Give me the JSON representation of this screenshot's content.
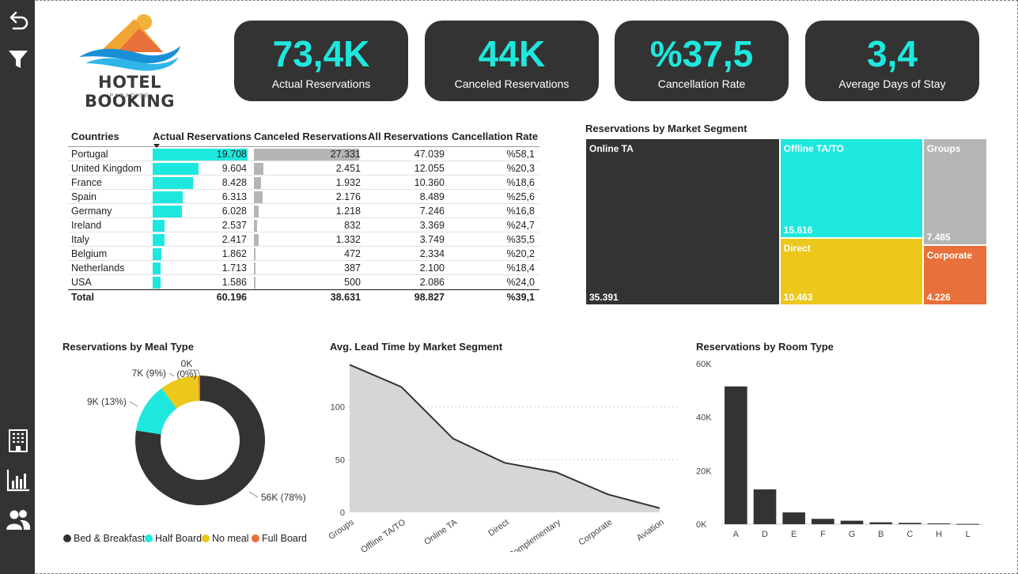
{
  "logo": {
    "title": "HOTEL BOOKING",
    "subtitle": "PARADISE"
  },
  "kpis": [
    {
      "value": "73,4K",
      "label": "Actual Reservations"
    },
    {
      "value": "44K",
      "label": "Canceled Reservations"
    },
    {
      "value": "%37,5",
      "label": "Cancellation Rate"
    },
    {
      "value": "3,4",
      "label": "Average Days of Stay"
    }
  ],
  "sidebar": {
    "icons": [
      "back-arrow-icon",
      "filter-icon",
      "building-icon",
      "bar-chart-icon",
      "users-icon"
    ]
  },
  "table": {
    "headers": [
      "Countries",
      "Actual Reservations",
      "Canceled Reservations",
      "All Reservations",
      "Cancellation Rate"
    ],
    "rows": [
      {
        "country": "Portugal",
        "actual": "19.708",
        "canceled": "27.331",
        "all": "47.039",
        "rate": "%58,1",
        "actual_n": 19708,
        "canceled_n": 27331
      },
      {
        "country": "United Kingdom",
        "actual": "9.604",
        "canceled": "2.451",
        "all": "12.055",
        "rate": "%20,3",
        "actual_n": 9604,
        "canceled_n": 2451
      },
      {
        "country": "France",
        "actual": "8.428",
        "canceled": "1.932",
        "all": "10.360",
        "rate": "%18,6",
        "actual_n": 8428,
        "canceled_n": 1932
      },
      {
        "country": "Spain",
        "actual": "6.313",
        "canceled": "2.176",
        "all": "8.489",
        "rate": "%25,6",
        "actual_n": 6313,
        "canceled_n": 2176
      },
      {
        "country": "Germany",
        "actual": "6.028",
        "canceled": "1.218",
        "all": "7.246",
        "rate": "%16,8",
        "actual_n": 6028,
        "canceled_n": 1218
      },
      {
        "country": "Ireland",
        "actual": "2.537",
        "canceled": "832",
        "all": "3.369",
        "rate": "%24,7",
        "actual_n": 2537,
        "canceled_n": 832
      },
      {
        "country": "Italy",
        "actual": "2.417",
        "canceled": "1.332",
        "all": "3.749",
        "rate": "%35,5",
        "actual_n": 2417,
        "canceled_n": 1332
      },
      {
        "country": "Belgium",
        "actual": "1.862",
        "canceled": "472",
        "all": "2.334",
        "rate": "%20,2",
        "actual_n": 1862,
        "canceled_n": 472
      },
      {
        "country": "Netherlands",
        "actual": "1.713",
        "canceled": "387",
        "all": "2.100",
        "rate": "%18,4",
        "actual_n": 1713,
        "canceled_n": 387
      },
      {
        "country": "USA",
        "actual": "1.586",
        "canceled": "500",
        "all": "2.086",
        "rate": "%24,0",
        "actual_n": 1586,
        "canceled_n": 500
      }
    ],
    "total": {
      "label": "Total",
      "actual": "60.196",
      "canceled": "38.631",
      "all": "98.827",
      "rate": "%39,1"
    }
  },
  "colors": {
    "accent": "#1ee8de",
    "dark": "#333333",
    "grey": "#b5b5b5",
    "yellow": "#ecc71c",
    "orange": "#e8703a"
  },
  "chart_data": [
    {
      "type": "treemap",
      "title": "Reservations by Market Segment",
      "items": [
        {
          "name": "Online TA",
          "value": 35391,
          "label": "35.391",
          "color": "#333333"
        },
        {
          "name": "Offline TA/TO",
          "value": 15616,
          "label": "15.616",
          "color": "#1ee8de"
        },
        {
          "name": "Direct",
          "value": 10463,
          "label": "10.463",
          "color": "#ecc71c"
        },
        {
          "name": "Groups",
          "value": 7485,
          "label": "7.485",
          "color": "#b5b5b5"
        },
        {
          "name": "Corporate",
          "value": 4226,
          "label": "4.226",
          "color": "#e8703a"
        }
      ]
    },
    {
      "type": "pie",
      "title": "Reservations by Meal Type",
      "slices": [
        {
          "name": "Bed & Breakfast",
          "value": 56,
          "label": "56K (78%)",
          "color": "#333333"
        },
        {
          "name": "Half Board",
          "value": 9,
          "label": "9K (13%)",
          "color": "#1ee8de"
        },
        {
          "name": "No meal",
          "value": 7,
          "label": "7K (9%)",
          "color": "#ecc71c"
        },
        {
          "name": "Full Board",
          "value": 0.3,
          "label": "0K (0%)",
          "color": "#e8703a"
        }
      ],
      "legend": [
        "Bed & Breakfast",
        "Half Board",
        "No meal",
        "Full Board"
      ]
    },
    {
      "type": "area",
      "title": "Avg. Lead Time by Market Segment",
      "categories": [
        "Groups",
        "Offline TA/TO",
        "Online TA",
        "Direct",
        "Complementary",
        "Corporate",
        "Aviation"
      ],
      "values": [
        140,
        119,
        70,
        47,
        38,
        17,
        4
      ],
      "ylim": [
        0,
        150
      ],
      "yticks": [
        0,
        50,
        100
      ],
      "grid": true
    },
    {
      "type": "bar",
      "title": "Reservations by Room Type",
      "categories": [
        "A",
        "D",
        "E",
        "F",
        "G",
        "B",
        "C",
        "H",
        "L"
      ],
      "values": [
        51500,
        13000,
        4400,
        2000,
        1300,
        700,
        500,
        300,
        100
      ],
      "ylim": [
        0,
        60000
      ],
      "yticks": [
        "0K",
        "20K",
        "40K",
        "60K"
      ]
    }
  ]
}
